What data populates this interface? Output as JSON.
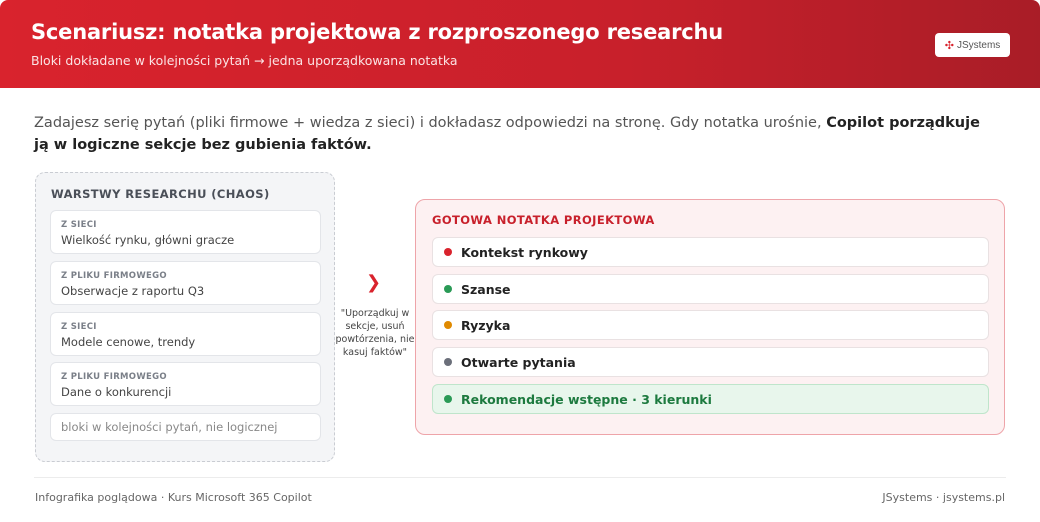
{
  "header": {
    "title": "Scenariusz: notatka projektowa z rozproszonego researchu",
    "subtitle": "Bloki dokładane w kolejności pytań → jedna uporządkowana notatka",
    "logo_text": "JSystems"
  },
  "intro": {
    "text": "Zadajesz serię pytań (pliki firmowe + wiedza z sieci) i dokładasz odpowiedzi na stronę. Gdy notatka urośnie, ",
    "bold": "Copilot porządkuje ją w logiczne sekcje bez gubienia faktów."
  },
  "left": {
    "title": "WARSTWY RESEARCHU (CHAOS)",
    "cards": [
      {
        "tag": "Z SIECI",
        "text": "Wielkość rynku, główni gracze"
      },
      {
        "tag": "Z PLIKU FIRMOWEGO",
        "text": "Obserwacje z raportu Q3"
      },
      {
        "tag": "Z SIECI",
        "text": "Modele cenowe, trendy"
      },
      {
        "tag": "Z PLIKU FIRMOWEGO",
        "text": "Dane o konkurencji"
      }
    ],
    "note": "bloki w kolejności pytań, nie logicznej"
  },
  "middle": {
    "prompt": "\"Uporządkuj w sekcje, usuń powtórzenia, nie kasuj faktów\""
  },
  "right": {
    "title": "GOTOWA NOTATKA PROJEKTOWA",
    "sections": [
      {
        "label": "Kontekst rynkowy",
        "color": "#d9232d"
      },
      {
        "label": "Szanse",
        "color": "#2a9a56"
      },
      {
        "label": "Ryzyka",
        "color": "#e08a00"
      },
      {
        "label": "Otwarte pytania",
        "color": "#6b6f7a"
      },
      {
        "label": "Rekomendacje wstępne · 3 kierunki",
        "color": "#2a9a56"
      }
    ]
  },
  "footer": {
    "left": "Infografika poglądowa · Kurs Microsoft 365 Copilot",
    "right": "JSystems · jsystems.pl"
  }
}
